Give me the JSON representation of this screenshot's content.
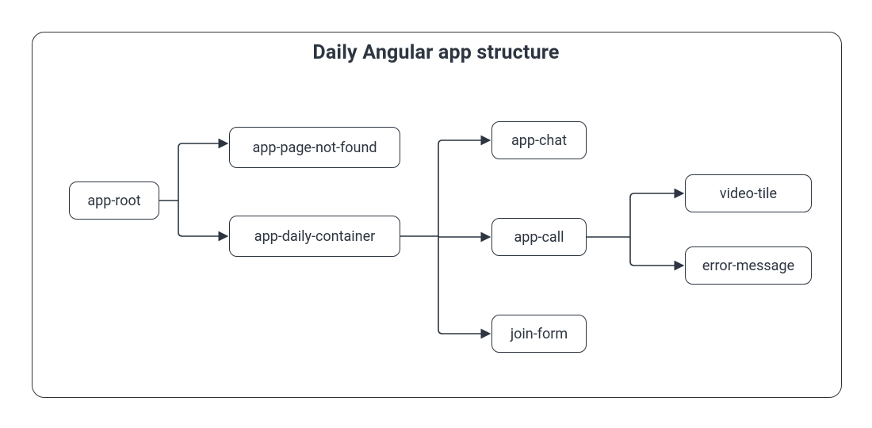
{
  "title": "Daily Angular app structure",
  "nodes": {
    "root": "app-root",
    "notFound": "app-page-not-found",
    "daily": "app-daily-container",
    "chat": "app-chat",
    "call": "app-call",
    "join": "join-form",
    "video": "video-tile",
    "error": "error-message"
  },
  "edges": [
    {
      "from": "root",
      "to": "notFound"
    },
    {
      "from": "root",
      "to": "daily"
    },
    {
      "from": "daily",
      "to": "chat"
    },
    {
      "from": "daily",
      "to": "call"
    },
    {
      "from": "daily",
      "to": "join"
    },
    {
      "from": "call",
      "to": "video"
    },
    {
      "from": "call",
      "to": "error"
    }
  ]
}
